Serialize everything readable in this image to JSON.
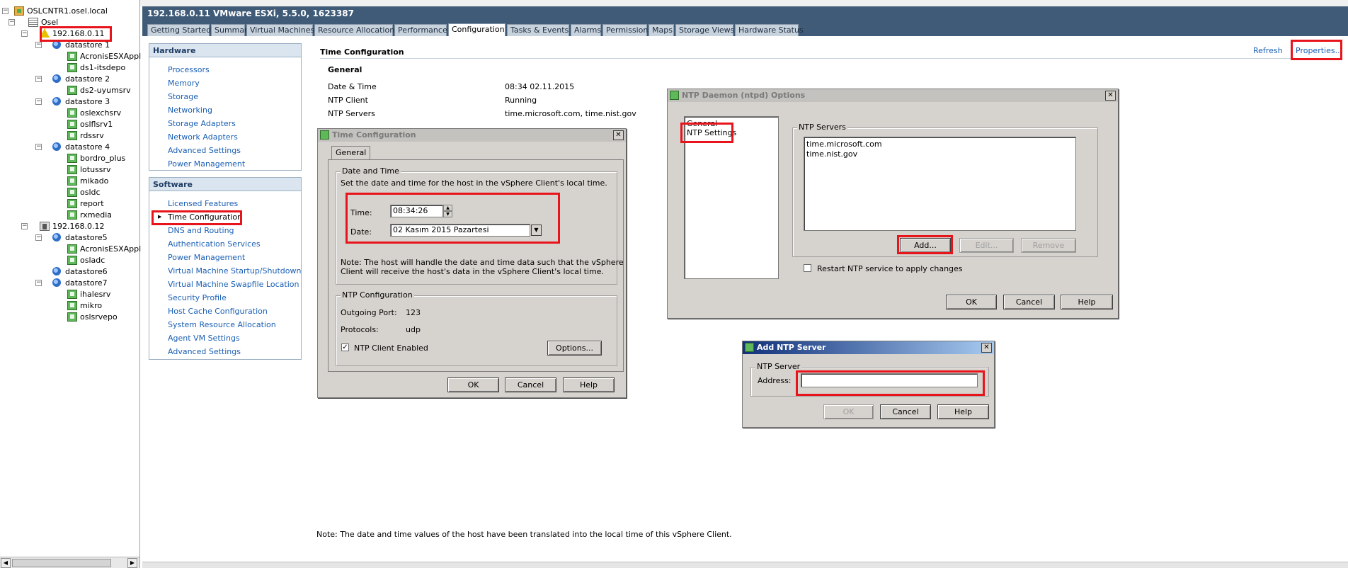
{
  "tree": {
    "items": [
      {
        "label": "OSLCNTR1.osel.local",
        "icon": "vcenter-icon",
        "toggle": "-"
      },
      {
        "label": "Osel",
        "icon": "datacenter-icon",
        "toggle": "-"
      },
      {
        "label": "192.168.0.11",
        "icon": "host-warning-icon",
        "toggle": "-"
      },
      {
        "label": "datastore 1",
        "icon": "datastore-icon",
        "toggle": "-"
      },
      {
        "label": "AcronisESXAppl",
        "icon": "vm-icon"
      },
      {
        "label": "ds1-itsdepo",
        "icon": "vm-icon"
      },
      {
        "label": "datastore 2",
        "icon": "datastore-icon",
        "toggle": "-"
      },
      {
        "label": "ds2-uyumsrv",
        "icon": "vm-icon"
      },
      {
        "label": "datastore 3",
        "icon": "datastore-icon",
        "toggle": "-"
      },
      {
        "label": "oslexchsrv",
        "icon": "vm-icon"
      },
      {
        "label": "oslflsrv1",
        "icon": "vm-icon"
      },
      {
        "label": "rdssrv",
        "icon": "vm-icon"
      },
      {
        "label": "datastore 4",
        "icon": "datastore-icon",
        "toggle": "-"
      },
      {
        "label": "bordro_plus",
        "icon": "vm-icon"
      },
      {
        "label": "lotussrv",
        "icon": "vm-icon"
      },
      {
        "label": "mikado",
        "icon": "vm-icon"
      },
      {
        "label": "osldc",
        "icon": "vm-icon"
      },
      {
        "label": "report",
        "icon": "vm-icon"
      },
      {
        "label": "rxmedia",
        "icon": "vm-icon"
      },
      {
        "label": "192.168.0.12",
        "icon": "host-icon",
        "toggle": "-"
      },
      {
        "label": "datastore5",
        "icon": "datastore-icon",
        "toggle": "-"
      },
      {
        "label": "AcronisESXAppl",
        "icon": "vm-icon"
      },
      {
        "label": "osladc",
        "icon": "vm-icon"
      },
      {
        "label": "datastore6",
        "icon": "datastore-icon"
      },
      {
        "label": "datastore7",
        "icon": "datastore-icon",
        "toggle": "-"
      },
      {
        "label": "ihalesrv",
        "icon": "vm-icon"
      },
      {
        "label": "mikro",
        "icon": "vm-icon"
      },
      {
        "label": "oslsrvepo",
        "icon": "vm-icon"
      }
    ]
  },
  "host": {
    "title": "192.168.0.11 VMware ESXi, 5.5.0, 1623387"
  },
  "tabs": [
    {
      "label": "Getting Started"
    },
    {
      "label": "Summary"
    },
    {
      "label": "Virtual Machines"
    },
    {
      "label": "Resource Allocation"
    },
    {
      "label": "Performance"
    },
    {
      "label": "Configuration",
      "active": true
    },
    {
      "label": "Tasks & Events"
    },
    {
      "label": "Alarms"
    },
    {
      "label": "Permissions"
    },
    {
      "label": "Maps"
    },
    {
      "label": "Storage Views"
    },
    {
      "label": "Hardware Status"
    }
  ],
  "hardware": {
    "heading": "Hardware",
    "items": [
      "Processors",
      "Memory",
      "Storage",
      "Networking",
      "Storage Adapters",
      "Network Adapters",
      "Advanced Settings",
      "Power Management"
    ]
  },
  "software": {
    "heading": "Software",
    "items": [
      "Licensed Features",
      "Time Configuration",
      "DNS and Routing",
      "Authentication Services",
      "Power Management",
      "Virtual Machine Startup/Shutdown",
      "Virtual Machine Swapfile Location",
      "Security Profile",
      "Host Cache Configuration",
      "System Resource Allocation",
      "Agent VM Settings",
      "Advanced Settings"
    ]
  },
  "main": {
    "section_title": "Time Configuration",
    "refresh": "Refresh",
    "properties": "Properties...",
    "general_heading": "General",
    "rows": [
      {
        "label": "Date & Time",
        "value": "08:34  02.11.2015"
      },
      {
        "label": "NTP Client",
        "value": "Running"
      },
      {
        "label": "NTP Servers",
        "value": "time.microsoft.com,  time.nist.gov"
      }
    ],
    "note": "Note: The date and time values of the host have been translated into the local time of this vSphere Client."
  },
  "time_dialog": {
    "title": "Time Configuration",
    "tab": "General",
    "dt_group": "Date and Time",
    "dt_desc": "Set the date and time for the host in the vSphere Client's local time.",
    "time_label": "Time:",
    "time_value": "08:34:26",
    "date_label": "Date:",
    "date_value": "02  Kasım  2015 Pazartesi",
    "note_line1": "Note: The host will handle the date and time data such that the vSphere",
    "note_line2": "Client will receive the host's data in the vSphere Client's local time.",
    "ntp_group": "NTP Configuration",
    "port_label": "Outgoing Port:",
    "port_value": "123",
    "proto_label": "Protocols:",
    "proto_value": "udp",
    "ntp_enabled_label": "NTP Client Enabled",
    "options_btn": "Options...",
    "ok": "OK",
    "cancel": "Cancel",
    "help": "Help"
  },
  "ntp_dialog": {
    "title": "NTP Daemon (ntpd) Options",
    "nav": [
      "General",
      "NTP Settings"
    ],
    "servers_group": "NTP Servers",
    "servers": [
      "time.microsoft.com",
      "time.nist.gov"
    ],
    "add": "Add...",
    "edit": "Edit...",
    "remove": "Remove",
    "restart_label": "Restart NTP service to apply changes",
    "ok": "OK",
    "cancel": "Cancel",
    "help": "Help"
  },
  "add_dialog": {
    "title": "Add NTP Server",
    "group": "NTP Server",
    "address_label": "Address:",
    "address_value": "",
    "ok": "OK",
    "cancel": "Cancel",
    "help": "Help"
  },
  "colors": {
    "header_bg": "#3f5b78",
    "highlight": "#e8141c",
    "link": "#1a5fb4"
  }
}
